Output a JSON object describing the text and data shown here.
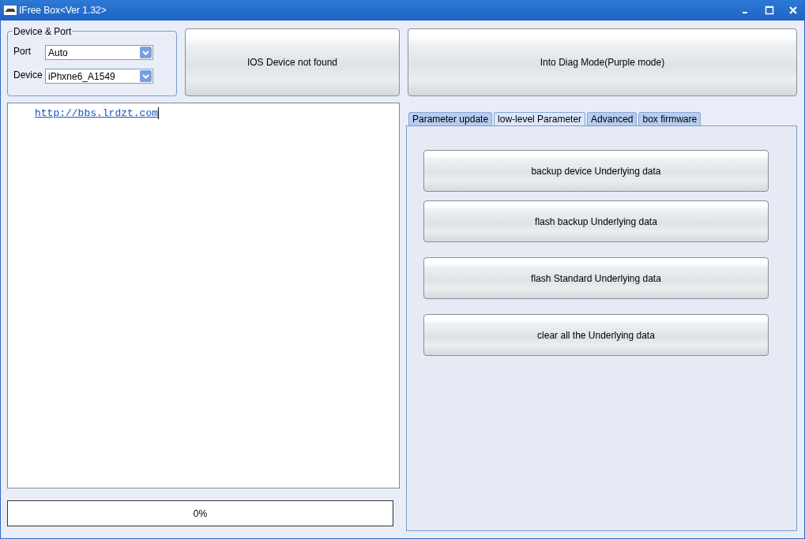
{
  "window": {
    "title": "IFree Box<Ver 1.32>"
  },
  "device_port": {
    "title": "Device & Port",
    "port_label": "Port",
    "port_value": "Auto",
    "device_label": "Device",
    "device_value": "iPhxne6_A1549"
  },
  "status_button": "IOS Device not found",
  "diag_button": "Into Diag Mode(Purple mode)",
  "log": {
    "link": "http://bbs.lrdzt.com"
  },
  "progress": {
    "level": 0,
    "reading": "0%"
  },
  "tabs": [
    {
      "label": "Parameter update",
      "selected": false
    },
    {
      "label": "low-level Parameter",
      "selected": true
    },
    {
      "label": "Advanced",
      "selected": false
    },
    {
      "label": "box firmware",
      "selected": false
    }
  ],
  "actions": [
    {
      "label": "backup device Underlying data"
    },
    {
      "label": "flash backup Underlying data"
    },
    {
      "label": "flash Standard Underlying data"
    },
    {
      "label": "clear all the Underlying data"
    }
  ]
}
